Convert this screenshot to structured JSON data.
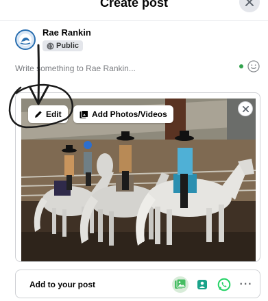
{
  "header": {
    "title": "Create post"
  },
  "user": {
    "name": "Rae Rankin",
    "privacy": "Public"
  },
  "composer": {
    "placeholder": "Write something to Rae Rankin..."
  },
  "media": {
    "edit_label": "Edit",
    "add_photos_label": "Add Photos/Videos"
  },
  "add_bar": {
    "label": "Add to your post",
    "icons": [
      "photo-icon",
      "tag-people-icon",
      "whatsapp-icon",
      "more-icon"
    ],
    "more": "···"
  },
  "colors": {
    "whatsapp": "#25d366",
    "photo": "#45bd62",
    "tag": "#1aa38a",
    "accent": "#1877f2"
  }
}
